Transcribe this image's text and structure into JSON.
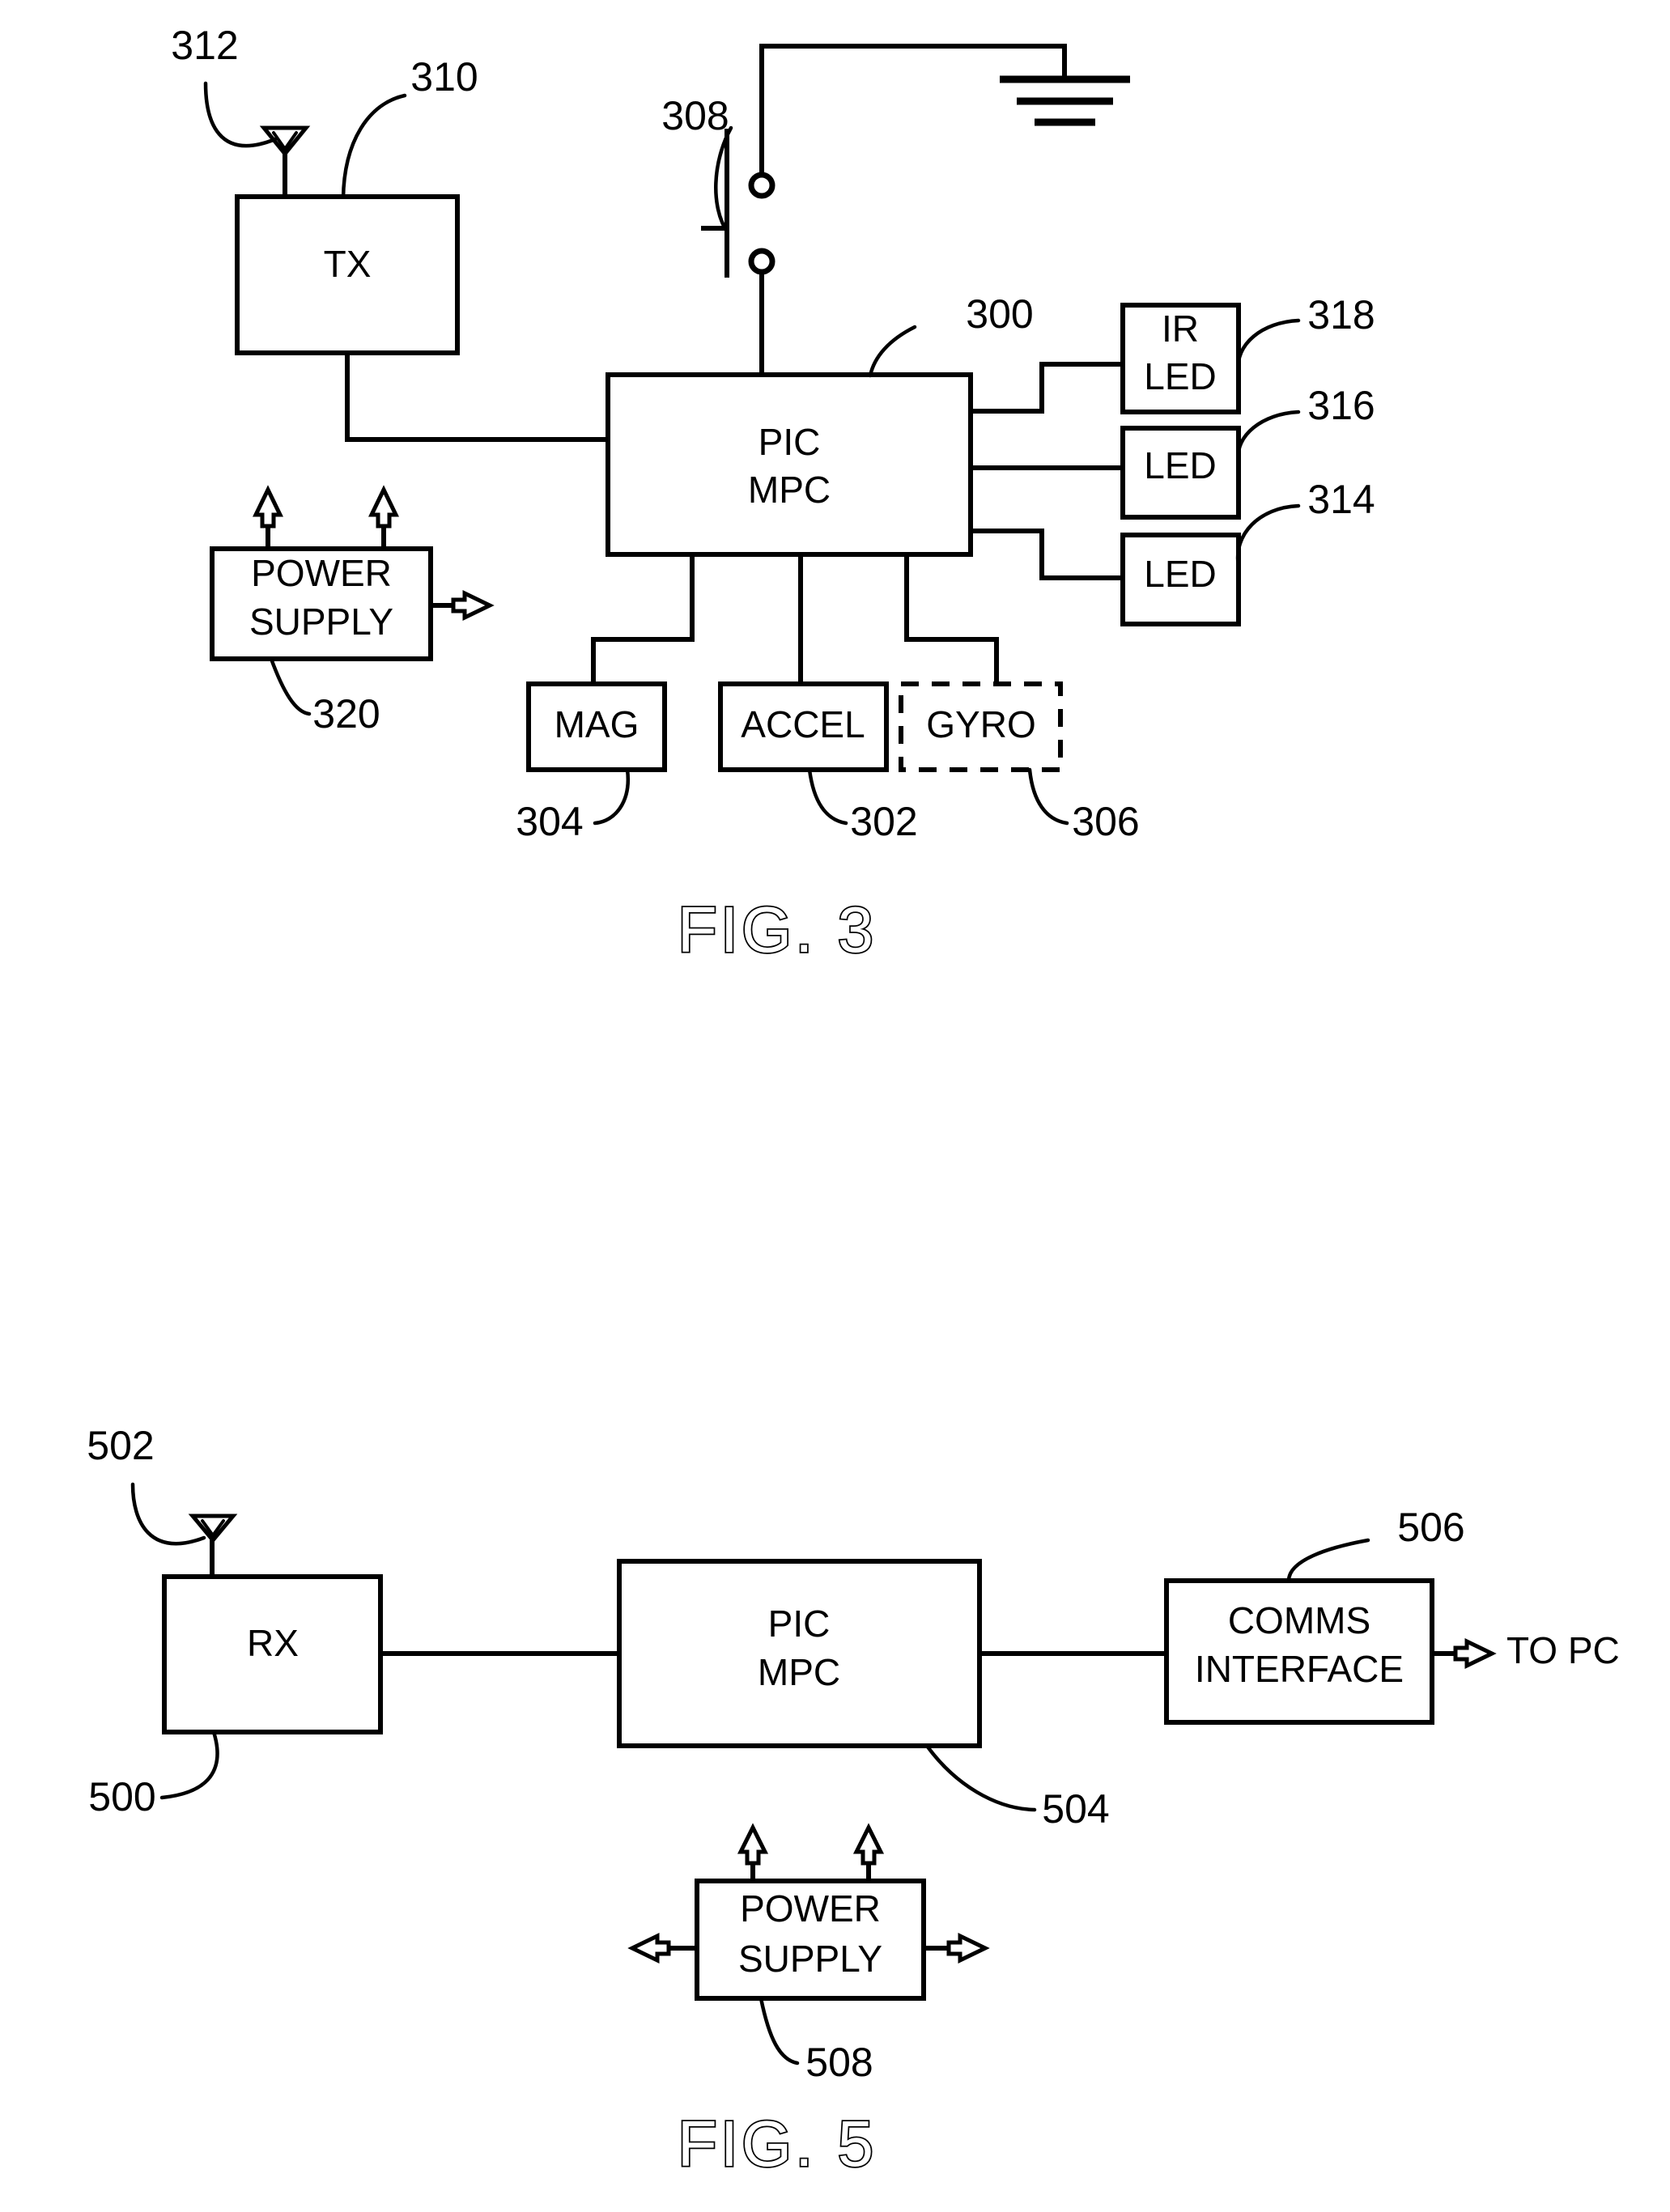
{
  "document": {
    "type": "patent-drawing-sheet",
    "figures": [
      "FIG. 3",
      "FIG. 5"
    ]
  },
  "fig3": {
    "caption": "FIG. 3",
    "blocks": {
      "tx": {
        "label": "TX",
        "ref": "310"
      },
      "pic_mpc": {
        "label_line1": "PIC",
        "label_line2": "MPC",
        "ref": "300"
      },
      "power_supply": {
        "label_line1": "POWER",
        "label_line2": "SUPPLY",
        "ref": "320"
      },
      "ir_led": {
        "label_line1": "IR",
        "label_line2": "LED",
        "ref": "318"
      },
      "led_upper": {
        "label": "LED",
        "ref": "316"
      },
      "led_lower": {
        "label": "LED",
        "ref": "314"
      },
      "mag": {
        "label": "MAG",
        "ref": "304"
      },
      "accel": {
        "label": "ACCEL",
        "ref": "302"
      },
      "gyro": {
        "label": "GYRO",
        "ref": "306",
        "style": "dashed-optional"
      }
    },
    "symbols": {
      "antenna": {
        "ref": "312",
        "icon": "antenna-icon"
      },
      "switch": {
        "ref": "308",
        "icon": "push-button-switch-icon"
      },
      "ground": {
        "icon": "ground-icon"
      }
    }
  },
  "fig5": {
    "caption": "FIG. 5",
    "blocks": {
      "rx": {
        "label": "RX",
        "ref": "500"
      },
      "pic_mpc": {
        "label_line1": "PIC",
        "label_line2": "MPC",
        "ref": "504"
      },
      "comms_interface": {
        "label_line1": "COMMS",
        "label_line2": "INTERFACE",
        "ref": "506"
      },
      "power_supply": {
        "label_line1": "POWER",
        "label_line2": "SUPPLY",
        "ref": "508"
      }
    },
    "symbols": {
      "antenna": {
        "ref": "502",
        "icon": "antenna-icon"
      }
    },
    "annotations": {
      "to_pc": "TO PC"
    }
  },
  "colors": {
    "ink": "#000000",
    "paper": "#ffffff"
  }
}
